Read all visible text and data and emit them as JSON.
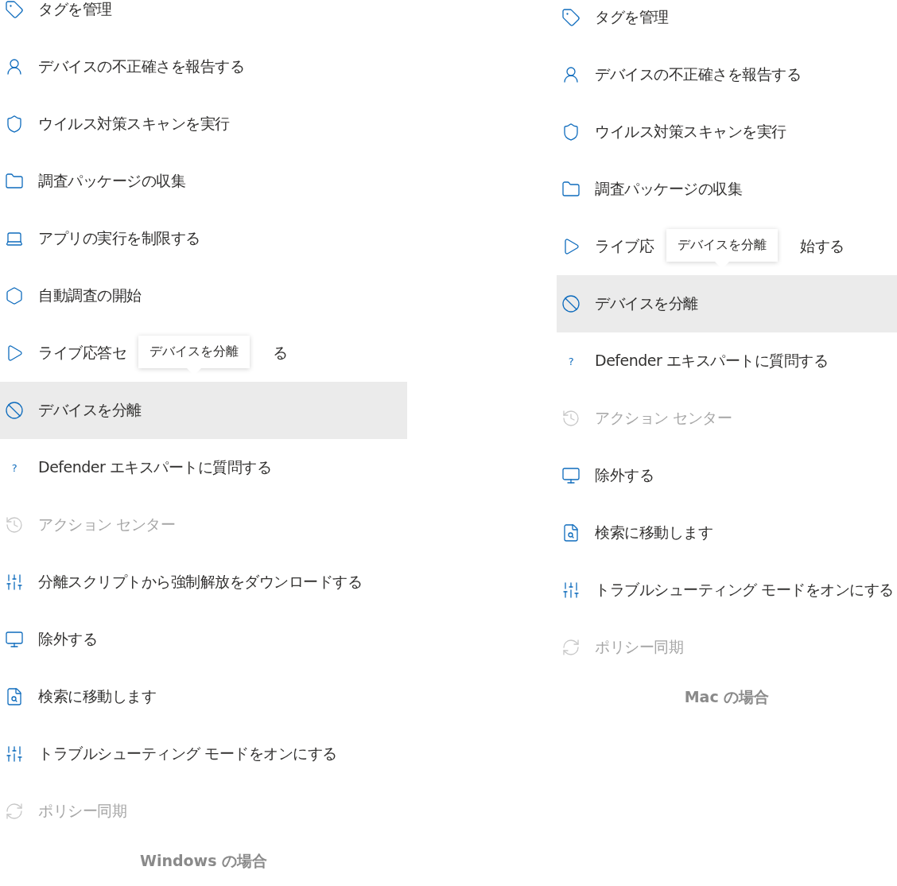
{
  "panels": [
    {
      "caption": "Windows の場合",
      "tooltip": {
        "text": "デバイスを分離"
      },
      "items": [
        {
          "kind": "tag",
          "label": "タグを管理",
          "selected": false,
          "disabled": false
        },
        {
          "kind": "report",
          "label": "デバイスの不正確さを報告する",
          "selected": false,
          "disabled": false
        },
        {
          "kind": "shield",
          "label": "ウイルス対策スキャンを実行",
          "selected": false,
          "disabled": false
        },
        {
          "kind": "package",
          "label": "調査パッケージの収集",
          "selected": false,
          "disabled": false
        },
        {
          "kind": "restrict",
          "label": "アプリの実行を制限する",
          "selected": false,
          "disabled": false
        },
        {
          "kind": "investigate",
          "label": "自動調査の開始",
          "selected": false,
          "disabled": false
        },
        {
          "kind": "live",
          "label": "ライブ応答セ",
          "label_after": "る",
          "selected": false,
          "disabled": false
        },
        {
          "kind": "isolate",
          "label": "デバイスを分離",
          "selected": true,
          "disabled": false
        },
        {
          "kind": "expert",
          "glyph": "?",
          "label": "Defender エキスパートに質問する",
          "selected": false,
          "disabled": false
        },
        {
          "kind": "action_center",
          "label": "アクション センター",
          "selected": false,
          "disabled": true
        },
        {
          "kind": "tools",
          "label": "分離スクリプトから強制解放をダウンロードする",
          "selected": false,
          "disabled": false
        },
        {
          "kind": "exclude",
          "label": "除外する",
          "selected": false,
          "disabled": false
        },
        {
          "kind": "hunt",
          "label": "検索に移動します",
          "selected": false,
          "disabled": false
        },
        {
          "kind": "tools",
          "label": "トラブルシューティング モードをオンにする",
          "selected": false,
          "disabled": false
        },
        {
          "kind": "sync",
          "label": "ポリシー同期",
          "selected": false,
          "disabled": true
        }
      ]
    },
    {
      "caption": "Mac の場合",
      "tooltip": {
        "text": "デバイスを分離"
      },
      "items": [
        {
          "kind": "tag",
          "label": "タグを管理",
          "selected": false,
          "disabled": false
        },
        {
          "kind": "report",
          "label": "デバイスの不正確さを報告する",
          "selected": false,
          "disabled": false
        },
        {
          "kind": "shield",
          "label": "ウイルス対策スキャンを実行",
          "selected": false,
          "disabled": false
        },
        {
          "kind": "package",
          "label": "調査パッケージの収集",
          "selected": false,
          "disabled": false
        },
        {
          "kind": "live",
          "label": "ライブ応",
          "label_after": "始する",
          "selected": false,
          "disabled": false
        },
        {
          "kind": "isolate",
          "label": "デバイスを分離",
          "selected": true,
          "disabled": false
        },
        {
          "kind": "expert",
          "glyph": "?",
          "label": "Defender エキスパートに質問する",
          "selected": false,
          "disabled": false
        },
        {
          "kind": "action_center",
          "label": "アクション センター",
          "selected": false,
          "disabled": true
        },
        {
          "kind": "exclude",
          "label": "除外する",
          "selected": false,
          "disabled": false
        },
        {
          "kind": "hunt",
          "label": "検索に移動します",
          "selected": false,
          "disabled": false
        },
        {
          "kind": "tools",
          "label": "トラブルシューティング モードをオンにする",
          "selected": false,
          "disabled": false
        },
        {
          "kind": "sync",
          "label": "ポリシー同期",
          "selected": false,
          "disabled": true
        }
      ]
    }
  ]
}
